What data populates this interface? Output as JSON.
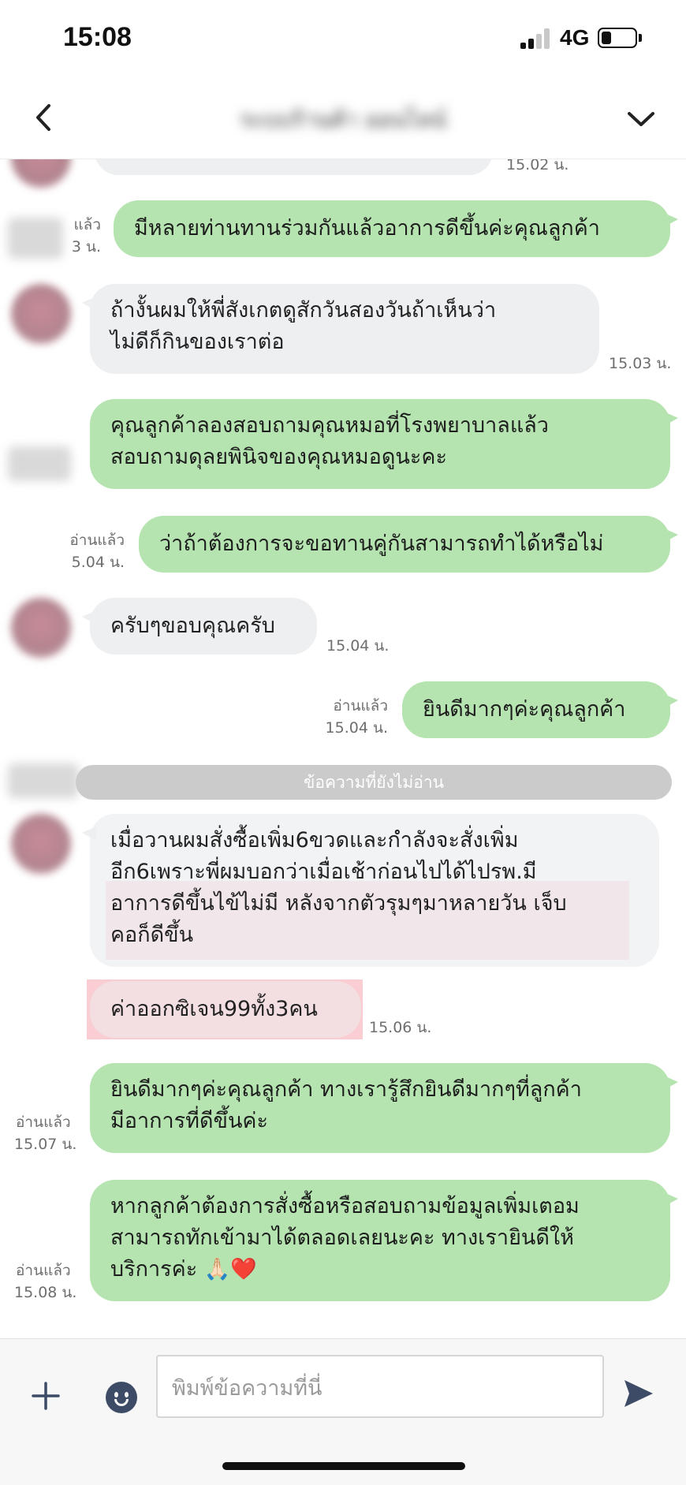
{
  "status_bar": {
    "time": "15:08",
    "network": "4G"
  },
  "header": {
    "contact_name": "ระบบร้านค้า ออนไลน์"
  },
  "messages": [
    {
      "dir": "out",
      "text": "",
      "time": "15.02 น.",
      "read": ""
    },
    {
      "dir": "out",
      "text": "มีหลายท่านทานร่วมกันแล้วอาการดีขึ้นค่ะคุณลูกค้า",
      "read": "แล้ว",
      "time": "3 น."
    },
    {
      "dir": "in",
      "text": "ถ้างั้นผมให้พี่สังเกตดูสักวันสองวันถ้าเห็นว่า\nไม่ดีก็กินของเราต่อ",
      "time": "15.03 น."
    },
    {
      "dir": "out",
      "text": "คุณลูกค้าลองสอบถามคุณหมอที่โรงพยาบาลแล้ว\nสอบถามดุลยพินิจของคุณหมอดูนะคะ",
      "read": "",
      "time": ""
    },
    {
      "dir": "out",
      "text": "ว่าถ้าต้องการจะขอทานคู่กันสามารถทำได้หรือไม่",
      "read": "อ่านแล้ว",
      "time": "5.04 น."
    },
    {
      "dir": "in",
      "text": "ครับๆขอบคุณครับ",
      "time": "15.04 น."
    },
    {
      "dir": "out",
      "text": "ยินดีมากๆค่ะคุณลูกค้า",
      "read": "อ่านแล้ว",
      "time": "15.04 น."
    },
    {
      "dir": "in",
      "text": "เมื่อวานผมสั่งซื้อเพิ่ม6ขวดและกำลังจะสั่งเพิ่ม\nอีก6เพราะพี่ผมบอกว่าเมื่อเช้าก่อนไปได้ไปรพ.มี\nอาการดีขึ้นไข้ไม่มี หลังจากตัวรุมๆมาหลายวัน เจ็บ\nคอก็ดีขึ้น",
      "time": ""
    },
    {
      "dir": "in",
      "text": "ค่าออกซิเจน99ทั้ง3คน",
      "time": "15.06 น."
    },
    {
      "dir": "out",
      "text": "ยินดีมากๆค่ะคุณลูกค้า ทางเรารู้สึกยินดีมากๆที่ลูกค้า\nมีอาการที่ดีขึ้นค่ะ",
      "read": "อ่านแล้ว",
      "time": "15.07 น."
    },
    {
      "dir": "out",
      "text": "หากลูกค้าต้องการสั่งซื้อหรือสอบถามข้อมูลเพิ่มเตอม\nสามารถทักเข้ามาได้ตลอดเลยนะคะ ทางเรายินดีให้\nบริการค่ะ 🙏🏻❤️",
      "read": "อ่านแล้ว",
      "time": "15.08 น."
    }
  ],
  "unread_divider": "ข้อความที่ยังไม่อ่าน",
  "composer": {
    "placeholder": "พิมพ์ข้อความที่นี่"
  },
  "colors": {
    "outgoing_bubble": "#b5e4b0",
    "incoming_bubble": "#eeeff1",
    "highlight": "#f0828c"
  },
  "icons": [
    "back-icon",
    "chevron-down-icon",
    "plus-icon",
    "emoji-icon",
    "send-icon"
  ]
}
